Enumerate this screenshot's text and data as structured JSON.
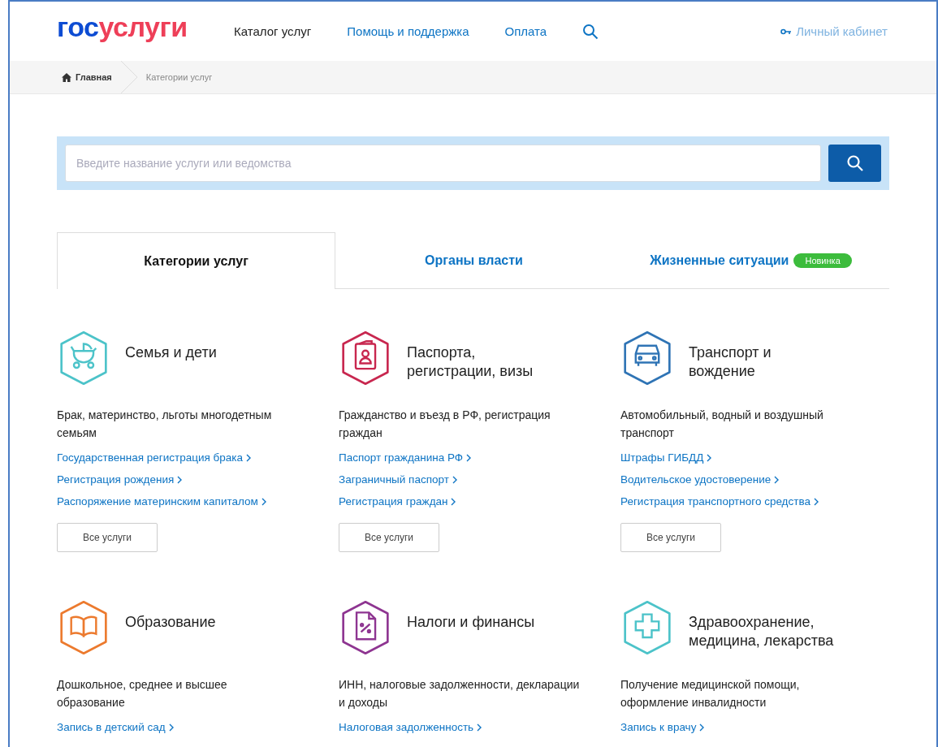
{
  "header": {
    "logo": {
      "part_1": "гос",
      "part_2": "услуги"
    },
    "nav": [
      {
        "label": "Каталог услуг",
        "selected": true
      },
      {
        "label": "Помощь и поддержка",
        "selected": false
      },
      {
        "label": "Оплата",
        "selected": false
      }
    ],
    "account": "Личный кабинет"
  },
  "breadcrumbs": [
    "Главная",
    "Категории услуг"
  ],
  "search": {
    "placeholder": "Введите название услуги или ведомства"
  },
  "tabs": [
    {
      "label": "Категории услуг",
      "selected": true
    },
    {
      "label": "Органы власти",
      "selected": false
    },
    {
      "label": "Жизненные ситуации",
      "selected": false,
      "badge": "Новинка"
    }
  ],
  "categories": [
    {
      "title": "Семья и дети",
      "color": "#4cc3c9",
      "description": "Брак, материнство, льготы многодетным семьям",
      "links": [
        "Государственная регистрация брака",
        "Регистрация рождения",
        "Распоряжение материнским капиталом"
      ],
      "button": "Все услуги"
    },
    {
      "title": "Паспорта, регистрации, визы",
      "color": "#c8274f",
      "description": "Гражданство и въезд в РФ, регистрация граждан",
      "links": [
        "Паспорт гражданина РФ",
        "Заграничный паспорт",
        "Регистрация граждан"
      ],
      "button": "Все услуги"
    },
    {
      "title": "Транспорт и вождение",
      "color": "#2f74b5",
      "description": "Автомобильный, водный и воздушный транспорт",
      "links": [
        "Штрафы ГИБДД",
        "Водительское удостоверение",
        "Регистрация транспортного средства"
      ],
      "button": "Все услуги"
    },
    {
      "title": "Образование",
      "color": "#ec7a2e",
      "description": "Дошкольное, среднее и высшее образование",
      "links": [
        "Запись в детский сад"
      ]
    },
    {
      "title": "Налоги и финансы",
      "color": "#8e3591",
      "description": "ИНН, налоговые задолженности, декларации и доходы",
      "links": [
        "Налоговая задолженность"
      ]
    },
    {
      "title": "Здравоохранение, медицина, лекарства",
      "color": "#4cc3c9",
      "description": "Получение медицинской помощи, оформление инвалидности",
      "links": [
        "Запись к врачу"
      ]
    }
  ]
}
